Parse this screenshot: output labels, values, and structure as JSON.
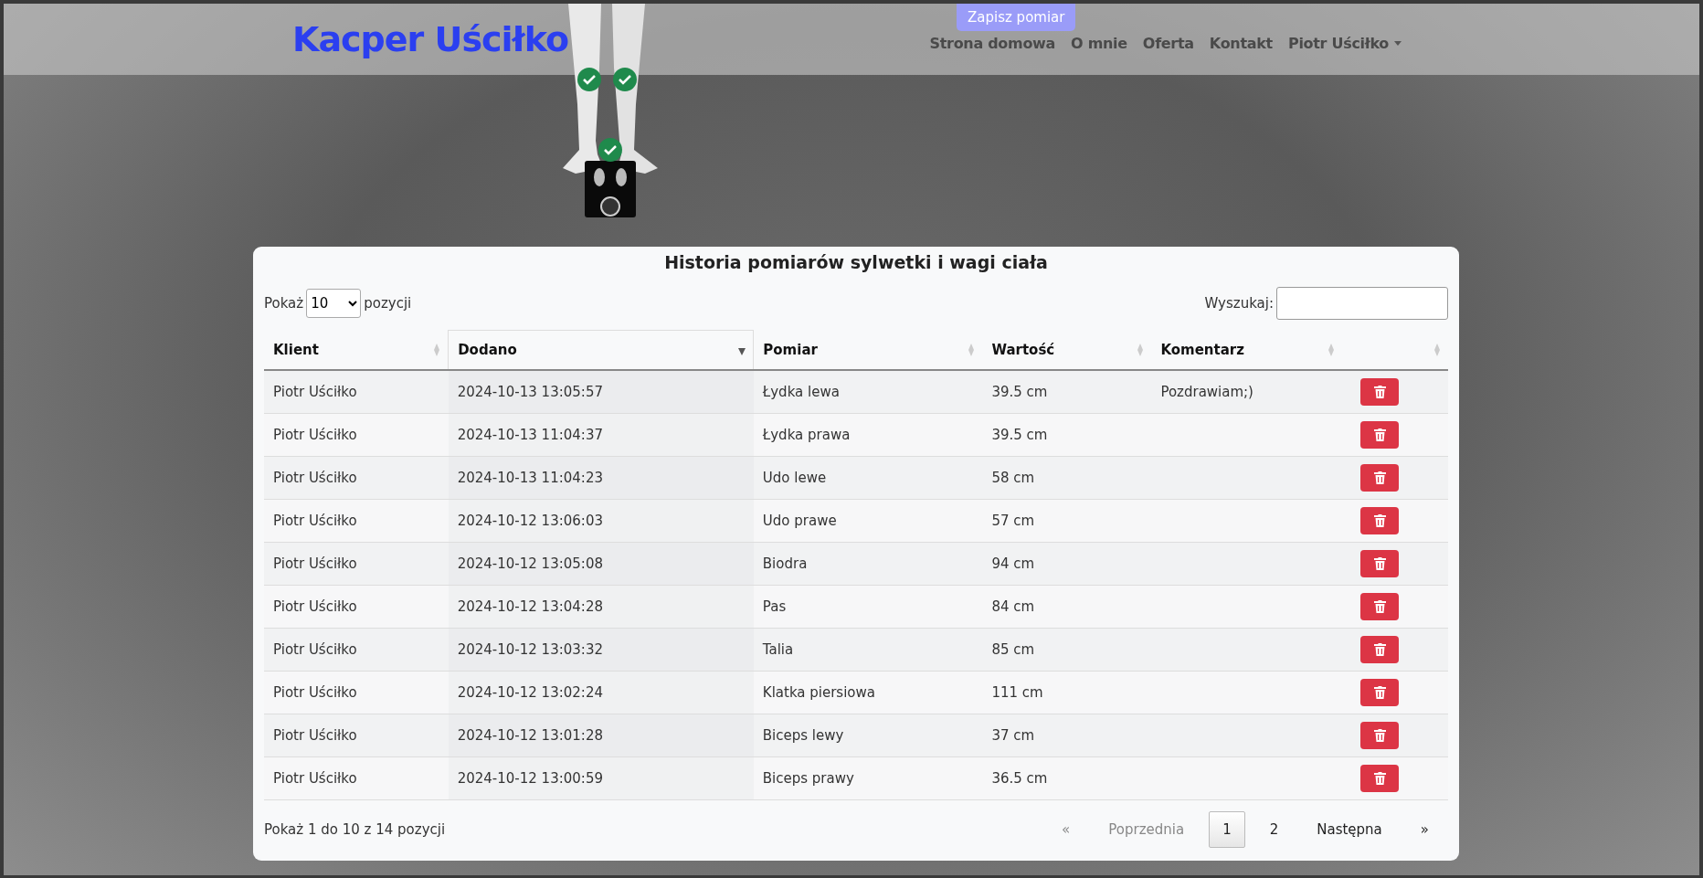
{
  "header": {
    "brand": "Kacper Uściłko",
    "save_button": "Zapisz pomiar",
    "nav": [
      {
        "label": "Strona domowa"
      },
      {
        "label": "O mnie"
      },
      {
        "label": "Oferta"
      },
      {
        "label": "Kontakt"
      },
      {
        "label": "Piotr Uściłko",
        "kind": "dropdown"
      }
    ]
  },
  "body_figure": {
    "checks": [
      {
        "checked": true
      },
      {
        "checked": true
      },
      {
        "checked": true
      }
    ]
  },
  "table": {
    "title": "Historia pomiarów sylwetki i wagi ciała",
    "length": {
      "before": "Pokaż",
      "value": "10",
      "after": "pozycji"
    },
    "search": {
      "label": "Wyszukaj:"
    },
    "columns": [
      {
        "label": "Klient",
        "sorted": false
      },
      {
        "label": "Dodano",
        "sorted": true
      },
      {
        "label": "Pomiar",
        "sorted": false
      },
      {
        "label": "Wartość",
        "sorted": false
      },
      {
        "label": "Komentarz",
        "sorted": false
      },
      {
        "sorted": false
      }
    ],
    "rows": [
      {
        "client": "Piotr Uściłko",
        "added": "2024-10-13 13:05:57",
        "measure": "Łydka lewa",
        "value": "39.5 cm",
        "comment": "Pozdrawiam;)"
      },
      {
        "client": "Piotr Uściłko",
        "added": "2024-10-13 11:04:37",
        "measure": "Łydka prawa",
        "value": "39.5 cm"
      },
      {
        "client": "Piotr Uściłko",
        "added": "2024-10-13 11:04:23",
        "measure": "Udo lewe",
        "value": "58 cm"
      },
      {
        "client": "Piotr Uściłko",
        "added": "2024-10-12 13:06:03",
        "measure": "Udo prawe",
        "value": "57 cm"
      },
      {
        "client": "Piotr Uściłko",
        "added": "2024-10-12 13:05:08",
        "measure": "Biodra",
        "value": "94 cm"
      },
      {
        "client": "Piotr Uściłko",
        "added": "2024-10-12 13:04:28",
        "measure": "Pas",
        "value": "84 cm"
      },
      {
        "client": "Piotr Uściłko",
        "added": "2024-10-12 13:03:32",
        "measure": "Talia",
        "value": "85 cm"
      },
      {
        "client": "Piotr Uściłko",
        "added": "2024-10-12 13:02:24",
        "measure": "Klatka piersiowa",
        "value": "111 cm"
      },
      {
        "client": "Piotr Uściłko",
        "added": "2024-10-12 13:01:28",
        "measure": "Biceps lewy",
        "value": "37 cm"
      },
      {
        "client": "Piotr Uściłko",
        "added": "2024-10-12 13:00:59",
        "measure": "Biceps prawy",
        "value": "36.5 cm"
      }
    ],
    "info": "Pokaż 1 do 10 z 14 pozycji",
    "pagination": [
      {
        "label": "«",
        "kind": "nav",
        "disabled": true
      },
      {
        "label": "Poprzednia",
        "kind": "nav",
        "disabled": true
      },
      {
        "label": "1",
        "kind": "page",
        "selected": true
      },
      {
        "label": "2",
        "kind": "page",
        "selected": false
      },
      {
        "label": "Następna",
        "kind": "nav",
        "disabled": false
      },
      {
        "label": "»",
        "kind": "nav",
        "disabled": false
      }
    ]
  }
}
